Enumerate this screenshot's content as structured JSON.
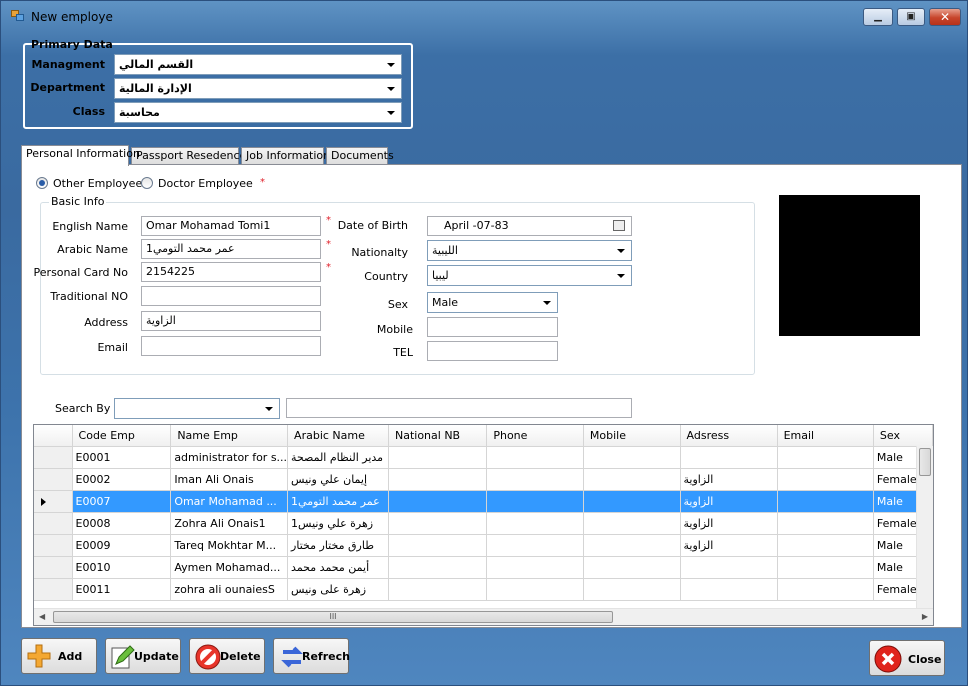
{
  "window": {
    "title": "New employe",
    "minimize_label": "▁",
    "maximize_label": "▣",
    "close_label": "✕"
  },
  "primary": {
    "title": "Primary Data",
    "managment_label": "Managment",
    "managment_value": "القسم المالي",
    "department_label": "Department",
    "department_value": "الإدارة المالية",
    "class_label": "Class",
    "class_value": "محاسبة"
  },
  "tabs": [
    "Personal Information",
    "Passport Resedence",
    "Job Information",
    "Documents"
  ],
  "personal": {
    "radio_other": "Other Employee",
    "radio_doctor": "Doctor Employee",
    "required_mark": "*",
    "group_title": "Basic Info",
    "english_name_label": "English Name",
    "english_name": "Omar Mohamad Tomi1",
    "arabic_name_label": "Arabic Name",
    "arabic_name": "عمر محمد التومي1",
    "card_label": "Personal Card No",
    "card": "2154225",
    "traditional_label": "Traditional NO",
    "traditional": "",
    "address_label": "Address",
    "address": "الزاوية",
    "email_label": "Email",
    "email": "",
    "dob_label": "Date of Birth",
    "dob": "April     -07-83",
    "nationality_label": "Nationalty",
    "nationality": "الليبية",
    "country_label": "Country",
    "country": "ليبيا",
    "sex_label": "Sex",
    "sex": "Male",
    "mobile_label": "Mobile",
    "mobile": "",
    "tel_label": "TEL",
    "tel": ""
  },
  "search": {
    "label": "Search By",
    "field": "",
    "text": ""
  },
  "grid": {
    "columns": [
      "Code Emp",
      "Name Emp",
      "Arabic Name",
      "National NB",
      "Phone",
      "Mobile",
      "Adsress",
      "Email",
      "Sex"
    ],
    "rows": [
      {
        "code": "E0001",
        "name": "administrator for s...",
        "arabic": "مدير النظام المصحة",
        "national": "",
        "phone": "",
        "mobile": "",
        "address": "",
        "email": "",
        "sex": "Male",
        "selected": false
      },
      {
        "code": "E0002",
        "name": "Iman Ali Onais",
        "arabic": "إيمان علي ونيس",
        "national": "",
        "phone": "",
        "mobile": "",
        "address": "الزاوية",
        "email": "",
        "sex": "Female",
        "selected": false
      },
      {
        "code": "E0007",
        "name": "Omar Mohamad ...",
        "arabic": "عمر محمد التومي1",
        "national": "",
        "phone": "",
        "mobile": "",
        "address": "الزاوية",
        "email": "",
        "sex": "Male",
        "selected": true
      },
      {
        "code": "E0008",
        "name": "Zohra Ali Onais1",
        "arabic": "زهرة علي ونيس1",
        "national": "",
        "phone": "",
        "mobile": "",
        "address": "الزاوية",
        "email": "",
        "sex": "Female",
        "selected": false
      },
      {
        "code": "E0009",
        "name": "Tareq Mokhtar M...",
        "arabic": "طارق مختار مختار",
        "national": "",
        "phone": "",
        "mobile": "",
        "address": "الزاوية",
        "email": "",
        "sex": "Male",
        "selected": false
      },
      {
        "code": "E0010",
        "name": "Aymen Mohamad...",
        "arabic": "أيمن محمد محمد",
        "national": "",
        "phone": "",
        "mobile": "",
        "address": "",
        "email": "",
        "sex": "Male",
        "selected": false
      },
      {
        "code": "E0011",
        "name": "zohra ali ounaiesS",
        "arabic": "زهرة على ونيس",
        "national": "",
        "phone": "",
        "mobile": "",
        "address": "",
        "email": "",
        "sex": "Female",
        "selected": false
      }
    ],
    "hscroll_grip": "III"
  },
  "buttons": {
    "add": "Add",
    "update": "Update",
    "delete": "Delete",
    "refresh": "Refrech",
    "close": "Close"
  },
  "colors": {
    "accent": "#3399ff",
    "window": "#3a6aa0",
    "required": "#e0202a"
  }
}
